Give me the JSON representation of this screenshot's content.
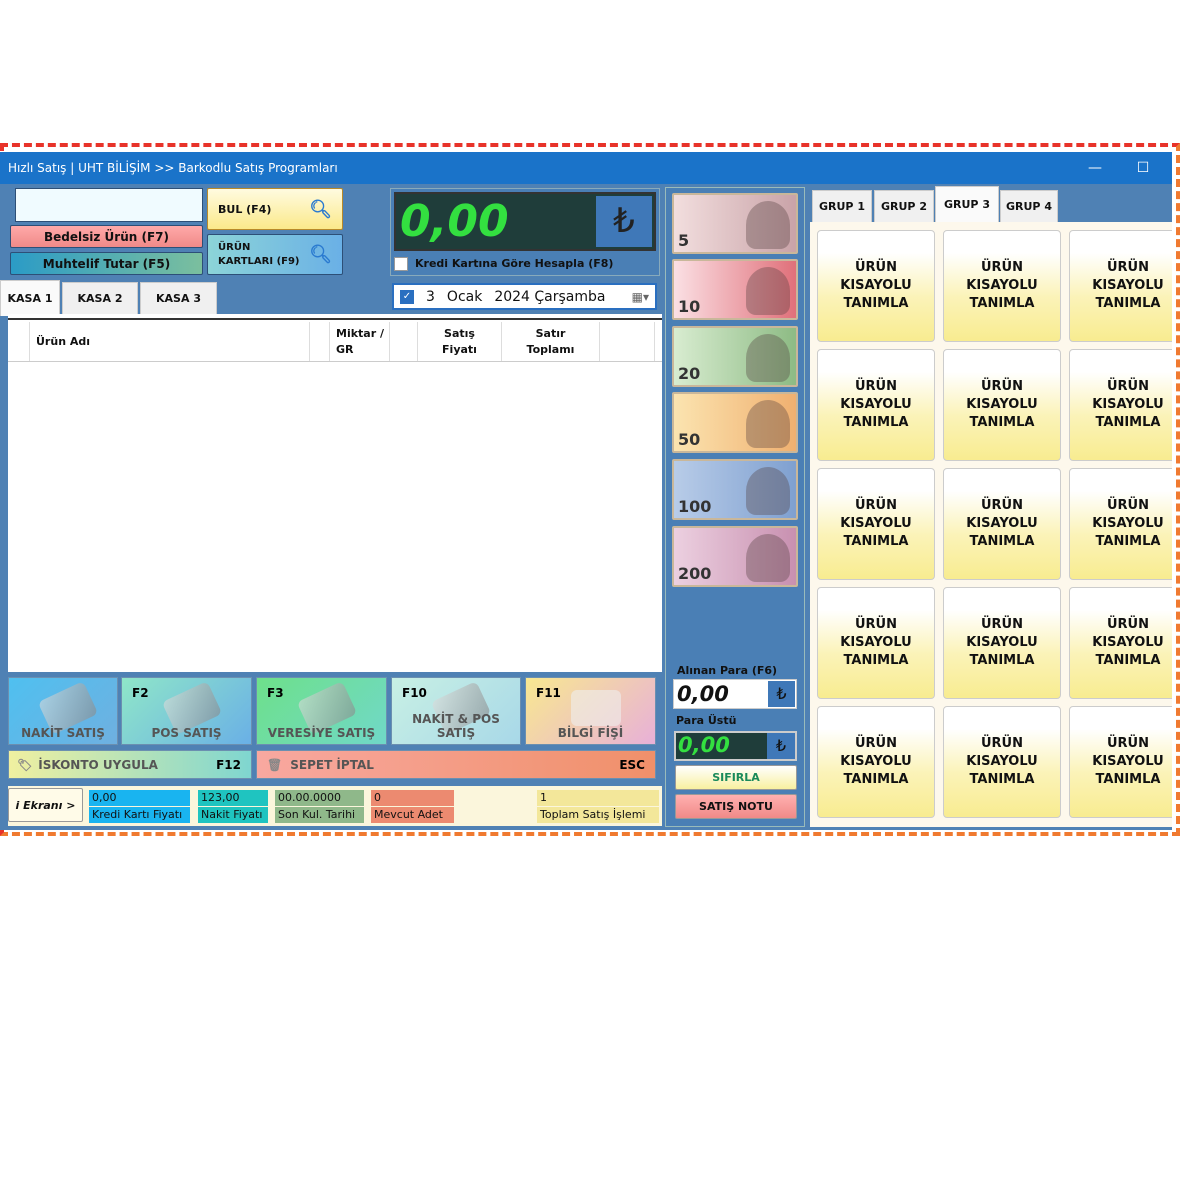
{
  "window": {
    "title": "Hızlı Satış | UHT BİLİŞİM >> Barkodlu Satış Programları",
    "minimize": "—",
    "maximize": "☐"
  },
  "search": {
    "value": "",
    "find_label": "BUL (F4)",
    "product_cards_label": "ÜRÜN KARTLARI (F9)",
    "free_item_label": "Bedelsiz Ürün (F7)",
    "misc_amount_label": "Muhtelif Tutar (F5)"
  },
  "kasa_tabs": [
    {
      "label": "KASA 1",
      "active": true
    },
    {
      "label": "KASA 2"
    },
    {
      "label": "KASA 3"
    }
  ],
  "display": {
    "total": "0,00",
    "currency": "₺",
    "credit_checkbox_label": "Kredi Kartına Göre Hesapla (F8)",
    "credit_checked": false
  },
  "date": {
    "checked": true,
    "day": "3",
    "month": "Ocak",
    "year_weekday": "2024 Çarşamba"
  },
  "table": {
    "columns": [
      "",
      "Ürün Adı",
      "",
      "Miktar / GR",
      "",
      "Satış Fiyatı",
      "Satır Toplamı",
      ""
    ],
    "rows": []
  },
  "actions": [
    {
      "key": "",
      "label": "NAKİT SATIŞ"
    },
    {
      "key": "F2",
      "label": "POS SATIŞ"
    },
    {
      "key": "F3",
      "label": "VERESİYE SATIŞ"
    },
    {
      "key": "F10",
      "label": "NAKİT & POS SATIŞ"
    },
    {
      "key": "F11",
      "label": "BİLGİ FİŞİ"
    }
  ],
  "discount": {
    "label": "İSKONTO UYGULA",
    "key": "F12"
  },
  "cancel": {
    "label": "SEPET İPTAL",
    "key": "ESC"
  },
  "status": {
    "screen_button": "i Ekranı >",
    "fields": [
      {
        "value": "0,00",
        "label": "Kredi Kartı Fiyatı",
        "color": "#19b4f0"
      },
      {
        "value": "123,00",
        "label": "Nakit Fiyatı",
        "color": "#1fc4c0"
      },
      {
        "value": "00.00.0000",
        "label": "Son Kul. Tarihi",
        "color": "#8fb88a"
      },
      {
        "value": "0",
        "label": "Mevcut Adet",
        "color": "#ec8a70"
      },
      {
        "value": "1",
        "label": "Toplam Satış İşlemi",
        "color": "#f3e79a"
      }
    ]
  },
  "banknotes": [
    {
      "value": "5",
      "color": "#c9a3a8"
    },
    {
      "value": "10",
      "color": "#e0707a"
    },
    {
      "value": "20",
      "color": "#8dbb84"
    },
    {
      "value": "50",
      "color": "#f0b070"
    },
    {
      "value": "100",
      "color": "#7fa0d0"
    },
    {
      "value": "200",
      "color": "#c890b0"
    }
  ],
  "payment": {
    "received_label": "Alınan Para (F6)",
    "received_value": "0,00",
    "change_label": "Para Üstü",
    "change_value": "0,00",
    "currency": "₺",
    "reset_label": "SIFIRLA",
    "note_label": "SATIŞ NOTU"
  },
  "group_tabs": [
    {
      "label": "GRUP 1"
    },
    {
      "label": "GRUP 2"
    },
    {
      "label": "GRUP 3",
      "active": true
    },
    {
      "label": "GRUP 4"
    }
  ],
  "shortcut_label": [
    "ÜRÜN",
    "KISAYOLU",
    "TANIMLA"
  ]
}
